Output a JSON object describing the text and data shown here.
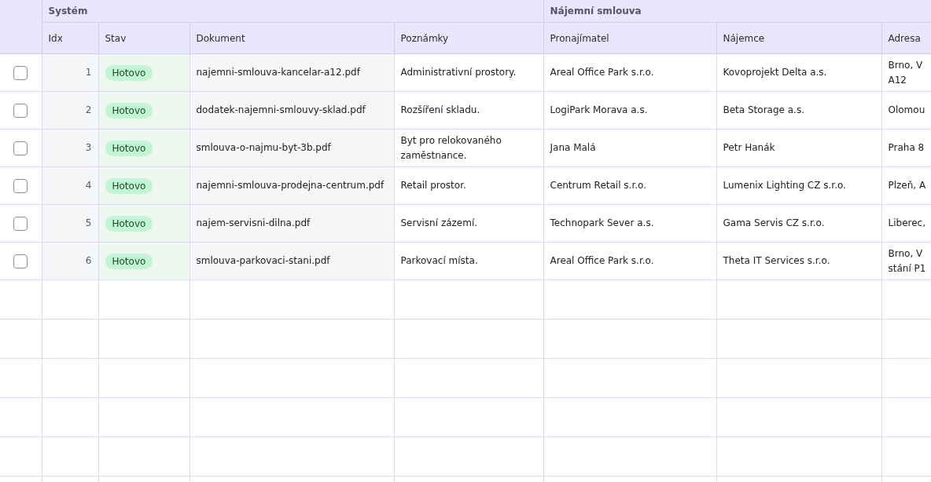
{
  "table": {
    "groups": [
      {
        "label": "Systém",
        "columns": [
          "Idx",
          "Stav",
          "Dokument",
          "Poznámky"
        ]
      },
      {
        "label": "Nájemní smlouva",
        "columns": [
          "Pronajímatel",
          "Nájemce",
          "Adresa"
        ]
      }
    ],
    "rows": [
      {
        "checked": false,
        "idx": "1",
        "status": "Hotovo",
        "document": "najemni-smlouva-kancelar-a12.pdf",
        "notes": "Administrativní prostory.",
        "landlord": "Areal Office Park s.r.o.",
        "tenant": "Kovoprojekt Delta a.s.",
        "address": "Brno, V\nA12"
      },
      {
        "checked": false,
        "idx": "2",
        "status": "Hotovo",
        "document": "dodatek-najemni-smlouvy-sklad.pdf",
        "notes": "Rozšíření skladu.",
        "landlord": "LogiPark Morava a.s.",
        "tenant": "Beta Storage a.s.",
        "address": "Olomou"
      },
      {
        "checked": false,
        "idx": "3",
        "status": "Hotovo",
        "document": "smlouva-o-najmu-byt-3b.pdf",
        "notes": "Byt pro relokovaného zaměstnance.",
        "landlord": "Jana Malá",
        "tenant": "Petr Hanák",
        "address": "Praha 8"
      },
      {
        "checked": false,
        "idx": "4",
        "status": "Hotovo",
        "document": "najemni-smlouva-prodejna-centrum.pdf",
        "notes": "Retail prostor.",
        "landlord": "Centrum Retail s.r.o.",
        "tenant": "Lumenix Lighting CZ s.r.o.",
        "address": "Plzeň, A"
      },
      {
        "checked": false,
        "idx": "5",
        "status": "Hotovo",
        "document": "najem-servisni-dilna.pdf",
        "notes": "Servisní zázemí.",
        "landlord": "Technopark Sever a.s.",
        "tenant": "Gama Servis CZ s.r.o.",
        "address": "Liberec,"
      },
      {
        "checked": false,
        "idx": "6",
        "status": "Hotovo",
        "document": "smlouva-parkovaci-stani.pdf",
        "notes": "Parkovací místa.",
        "landlord": "Areal Office Park s.r.o.",
        "tenant": "Theta IT Services s.r.o.",
        "address": "Brno, V\nstání P1"
      }
    ]
  }
}
